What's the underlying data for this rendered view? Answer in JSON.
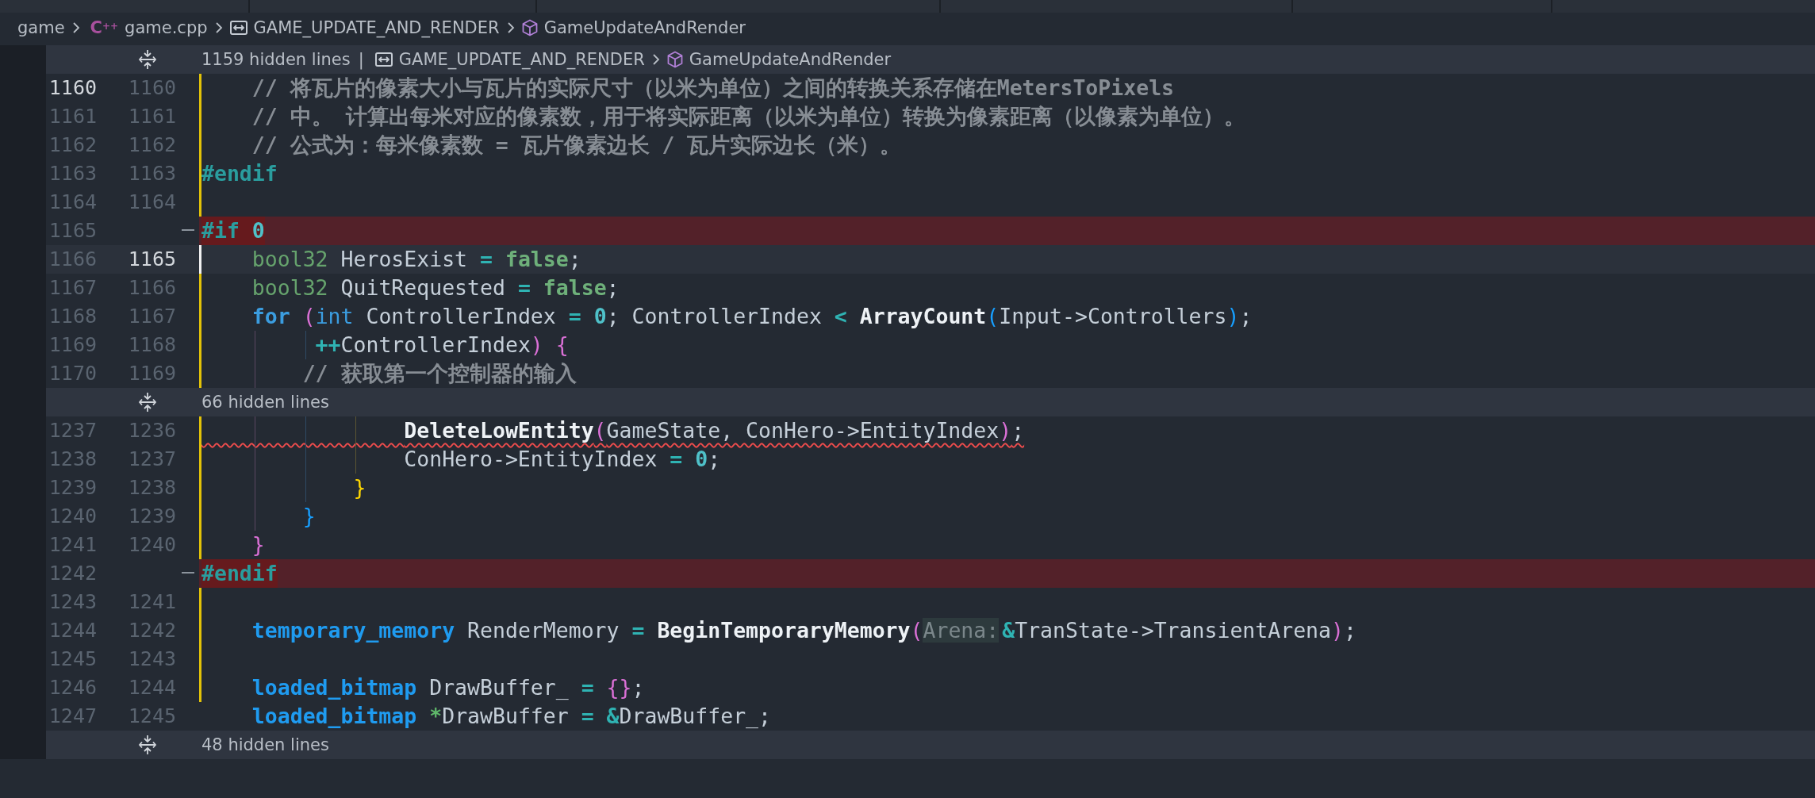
{
  "breadcrumb": [
    {
      "text": "game"
    },
    {
      "badge": "C$^{++}$",
      "text": "game.cpp"
    },
    {
      "kind": "macro",
      "text": "GAME_UPDATE_AND_RENDER"
    },
    {
      "kind": "function",
      "text": "GameUpdateAndRender"
    }
  ],
  "rows": [
    {
      "kind": "hidden",
      "label": "1159 hidden lines",
      "separator": "|",
      "context": [
        {
          "kind": "macro",
          "text": "GAME_UPDATE_AND_RENDER"
        },
        {
          "kind": "function",
          "text": "GameUpdateAndRender"
        }
      ]
    },
    {
      "kind": "line",
      "old": "1160",
      "new": "1160",
      "removed": false,
      "modified": true,
      "cursor": false,
      "error": false,
      "old_current": true,
      "new_current": false,
      "code": [
        {
          "kind": "comment",
          "t": "    // 将瓦片的像素大小与瓦片的实际尺寸（以米为单位）之间的转换关系存储在MetersToPixels"
        }
      ]
    },
    {
      "kind": "line",
      "old": "1161",
      "new": "1161",
      "removed": false,
      "modified": true,
      "cursor": false,
      "error": false,
      "old_current": false,
      "new_current": false,
      "code": [
        {
          "kind": "comment",
          "t": "    // 中。 计算出每米对应的像素数，用于将实际距离（以米为单位）转换为像素距离（以像素为单位）。"
        }
      ]
    },
    {
      "kind": "line",
      "old": "1162",
      "new": "1162",
      "removed": false,
      "modified": true,
      "cursor": false,
      "error": false,
      "old_current": false,
      "new_current": false,
      "code": [
        {
          "kind": "comment",
          "t": "    // 公式为：每米像素数 = 瓦片像素边长 / 瓦片实际边长（米）。"
        }
      ]
    },
    {
      "kind": "line",
      "old": "1163",
      "new": "1163",
      "removed": false,
      "modified": true,
      "cursor": false,
      "error": false,
      "old_current": false,
      "new_current": false,
      "code": [
        {
          "kind": "preproc",
          "t": "#endif"
        }
      ]
    },
    {
      "kind": "line",
      "old": "1164",
      "new": "1164",
      "removed": false,
      "modified": true,
      "cursor": false,
      "error": false,
      "old_current": false,
      "new_current": false
    },
    {
      "kind": "line",
      "old": "1165",
      "removed": true,
      "modified": false,
      "cursor": false,
      "error": false,
      "old_current": false,
      "new_current": false,
      "code": [
        {
          "kind": "preproc",
          "t": "#if "
        },
        {
          "kind": "number",
          "t": "0"
        }
      ]
    },
    {
      "kind": "line",
      "old": "1166",
      "new": "1165",
      "removed": false,
      "modified": true,
      "cursor": true,
      "error": false,
      "old_current": false,
      "new_current": true,
      "code": [
        {
          "kind": "type",
          "t": "    bool32"
        },
        {
          "kind": "plain",
          "t": " HerosExist "
        },
        {
          "kind": "op",
          "t": "= "
        },
        {
          "kind": "bool",
          "t": "false"
        },
        {
          "kind": "plain",
          "t": ";"
        }
      ]
    },
    {
      "kind": "line",
      "old": "1167",
      "new": "1166",
      "removed": false,
      "modified": true,
      "cursor": false,
      "error": false,
      "old_current": false,
      "new_current": false,
      "code": [
        {
          "kind": "type",
          "t": "    bool32"
        },
        {
          "kind": "plain",
          "t": " QuitRequested "
        },
        {
          "kind": "op",
          "t": "= "
        },
        {
          "kind": "bool",
          "t": "false"
        },
        {
          "kind": "plain",
          "t": ";"
        }
      ]
    },
    {
      "kind": "line",
      "old": "1168",
      "new": "1167",
      "removed": false,
      "modified": true,
      "cursor": false,
      "error": false,
      "old_current": false,
      "new_current": false,
      "code": [
        {
          "kind": "keyword",
          "t": "    for "
        },
        {
          "kind": "bracket",
          "t": "(",
          "color": "#da70d6"
        },
        {
          "kind": "keyword2",
          "t": "int"
        },
        {
          "kind": "plain",
          "t": " ControllerIndex "
        },
        {
          "kind": "op",
          "t": "= "
        },
        {
          "kind": "number",
          "t": "0"
        },
        {
          "kind": "plain",
          "t": "; ControllerIndex "
        },
        {
          "kind": "op",
          "t": "< "
        },
        {
          "kind": "fn",
          "t": "ArrayCount"
        },
        {
          "kind": "bracket",
          "t": "(",
          "color": "#179fff"
        },
        {
          "kind": "plain",
          "t": "Input->Controllers"
        },
        {
          "kind": "bracket",
          "t": ")",
          "color": "#179fff"
        },
        {
          "kind": "plain",
          "t": ";"
        }
      ]
    },
    {
      "kind": "line",
      "old": "1169",
      "new": "1168",
      "removed": false,
      "modified": true,
      "cursor": false,
      "error": false,
      "old_current": false,
      "new_current": false,
      "code": [
        {
          "kind": "op",
          "t": "         ++"
        },
        {
          "kind": "plain",
          "t": "ControllerIndex"
        },
        {
          "kind": "bracket",
          "t": ") ",
          "color": "#da70d6"
        },
        {
          "kind": "bracket",
          "t": "{",
          "color": "#da70d6"
        }
      ]
    },
    {
      "kind": "line",
      "old": "1170",
      "new": "1169",
      "removed": false,
      "modified": true,
      "cursor": false,
      "error": false,
      "old_current": false,
      "new_current": false,
      "code": [
        {
          "kind": "comment",
          "t": "        // 获取第一个控制器的输入"
        }
      ]
    },
    {
      "kind": "hidden",
      "label": "66 hidden lines"
    },
    {
      "kind": "line",
      "old": "1237",
      "new": "1236",
      "removed": false,
      "modified": true,
      "cursor": false,
      "error": true,
      "old_current": false,
      "new_current": false,
      "code": [
        {
          "kind": "fn",
          "t": "                DeleteLowEntity"
        },
        {
          "kind": "bracket",
          "t": "(",
          "color": "#da70d6"
        },
        {
          "kind": "plain",
          "t": "GameState, ConHero->EntityIndex"
        },
        {
          "kind": "bracket",
          "t": ")",
          "color": "#da70d6"
        },
        {
          "kind": "plain",
          "t": ";"
        }
      ]
    },
    {
      "kind": "line",
      "old": "1238",
      "new": "1237",
      "removed": false,
      "modified": true,
      "cursor": false,
      "error": false,
      "old_current": false,
      "new_current": false,
      "code": [
        {
          "kind": "plain",
          "t": "                ConHero->EntityIndex "
        },
        {
          "kind": "op",
          "t": "= "
        },
        {
          "kind": "number",
          "t": "0"
        },
        {
          "kind": "plain",
          "t": ";"
        }
      ]
    },
    {
      "kind": "line",
      "old": "1239",
      "new": "1238",
      "removed": false,
      "modified": true,
      "cursor": false,
      "error": false,
      "old_current": false,
      "new_current": false,
      "code": [
        {
          "kind": "bracket",
          "t": "            }",
          "color": "#ffd700"
        }
      ]
    },
    {
      "kind": "line",
      "old": "1240",
      "new": "1239",
      "removed": false,
      "modified": true,
      "cursor": false,
      "error": false,
      "old_current": false,
      "new_current": false,
      "code": [
        {
          "kind": "bracket",
          "t": "        }",
          "color": "#179fff"
        }
      ]
    },
    {
      "kind": "line",
      "old": "1241",
      "new": "1240",
      "removed": false,
      "modified": true,
      "cursor": false,
      "error": false,
      "old_current": false,
      "new_current": false,
      "code": [
        {
          "kind": "bracket",
          "t": "    }",
          "color": "#da70d6"
        }
      ]
    },
    {
      "kind": "line",
      "old": "1242",
      "removed": true,
      "modified": false,
      "cursor": false,
      "error": false,
      "old_current": false,
      "new_current": false,
      "code": [
        {
          "kind": "preproc",
          "t": "#endif"
        }
      ]
    },
    {
      "kind": "line",
      "old": "1243",
      "new": "1241",
      "removed": false,
      "modified": true,
      "cursor": false,
      "error": false,
      "old_current": false,
      "new_current": false
    },
    {
      "kind": "line",
      "old": "1244",
      "new": "1242",
      "removed": false,
      "modified": true,
      "cursor": false,
      "error": false,
      "old_current": false,
      "new_current": false,
      "code": [
        {
          "kind": "typebold",
          "t": "    temporary_memory"
        },
        {
          "kind": "plain",
          "t": " RenderMemory "
        },
        {
          "kind": "op",
          "t": "= "
        },
        {
          "kind": "fn",
          "t": "BeginTemporaryMemory"
        },
        {
          "kind": "bracket",
          "t": "(",
          "color": "#da70d6"
        },
        {
          "kind": "hint",
          "t": "Arena:"
        },
        {
          "kind": "op",
          "t": "&"
        },
        {
          "kind": "plain",
          "t": "TranState->TransientArena"
        },
        {
          "kind": "bracket",
          "t": ")",
          "color": "#da70d6"
        },
        {
          "kind": "plain",
          "t": ";"
        }
      ]
    },
    {
      "kind": "line",
      "old": "1245",
      "new": "1243",
      "removed": false,
      "modified": true,
      "cursor": false,
      "error": false,
      "old_current": false,
      "new_current": false
    },
    {
      "kind": "line",
      "old": "1246",
      "new": "1244",
      "removed": false,
      "modified": true,
      "cursor": false,
      "error": false,
      "old_current": false,
      "new_current": false,
      "code": [
        {
          "kind": "typebold",
          "t": "    loaded_bitmap"
        },
        {
          "kind": "plain",
          "t": " DrawBuffer_ "
        },
        {
          "kind": "op",
          "t": "= "
        },
        {
          "kind": "bracket",
          "t": "{",
          "color": "#da70d6"
        },
        {
          "kind": "bracket",
          "t": "}",
          "color": "#da70d6"
        },
        {
          "kind": "plain",
          "t": ";"
        }
      ]
    },
    {
      "kind": "line",
      "old": "1247",
      "new": "1245",
      "removed": false,
      "modified": false,
      "cursor": false,
      "error": false,
      "old_current": false,
      "new_current": false,
      "code": [
        {
          "kind": "typebold",
          "t": "    loaded_bitmap "
        },
        {
          "kind": "deref",
          "t": "*"
        },
        {
          "kind": "plain",
          "t": "DrawBuffer "
        },
        {
          "kind": "op",
          "t": "= &"
        },
        {
          "kind": "plain",
          "t": "DrawBuffer_;"
        }
      ]
    },
    {
      "kind": "hidden",
      "label": "48 hidden lines"
    }
  ]
}
